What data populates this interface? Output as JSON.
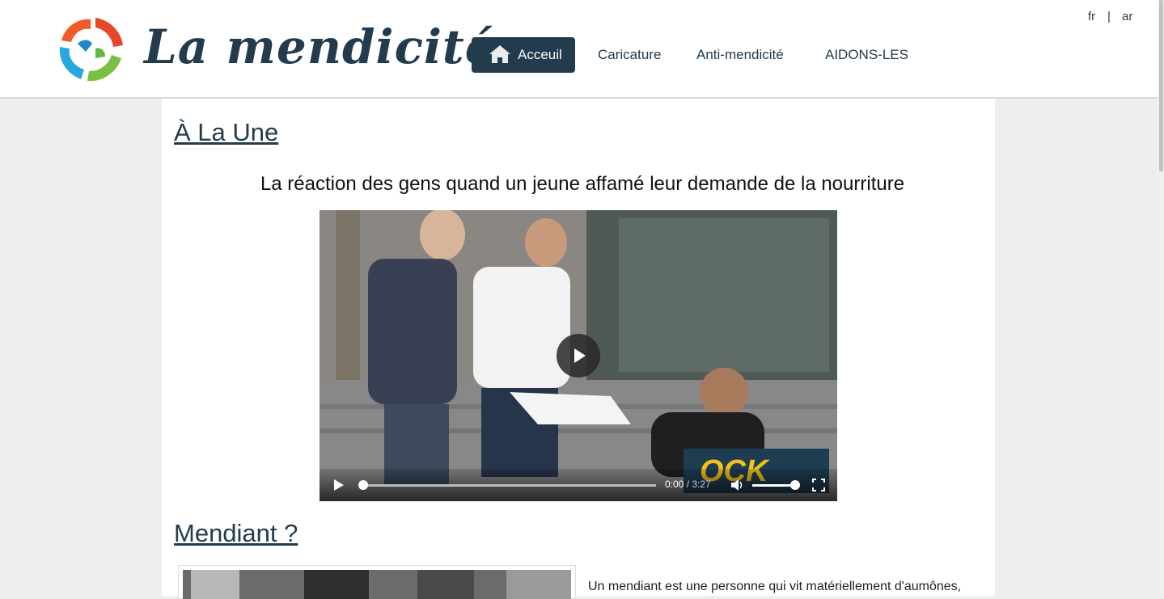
{
  "header": {
    "brand": "La mendicité",
    "lang": {
      "fr": "fr",
      "sep": "|",
      "ar": "ar"
    },
    "nav": {
      "home": "Acceuil",
      "caricature": "Caricature",
      "anti": "Anti-mendicité",
      "aidons": "AIDONS-LES"
    }
  },
  "main": {
    "section1_title": "À La Une",
    "headline": "La réaction des gens quand un jeune affamé leur demande de la nourriture",
    "video": {
      "current_time": "0:00",
      "duration": "/ 3:27",
      "progress": 0.0,
      "volume": 0.95
    },
    "section2_title": "Mendiant ?",
    "intro_text": "Un mendiant est une personne qui vit matériellement d'aumônes,"
  },
  "colors": {
    "accent": "#223b4d",
    "background": "#eeeeee",
    "panel": "#ffffff"
  }
}
